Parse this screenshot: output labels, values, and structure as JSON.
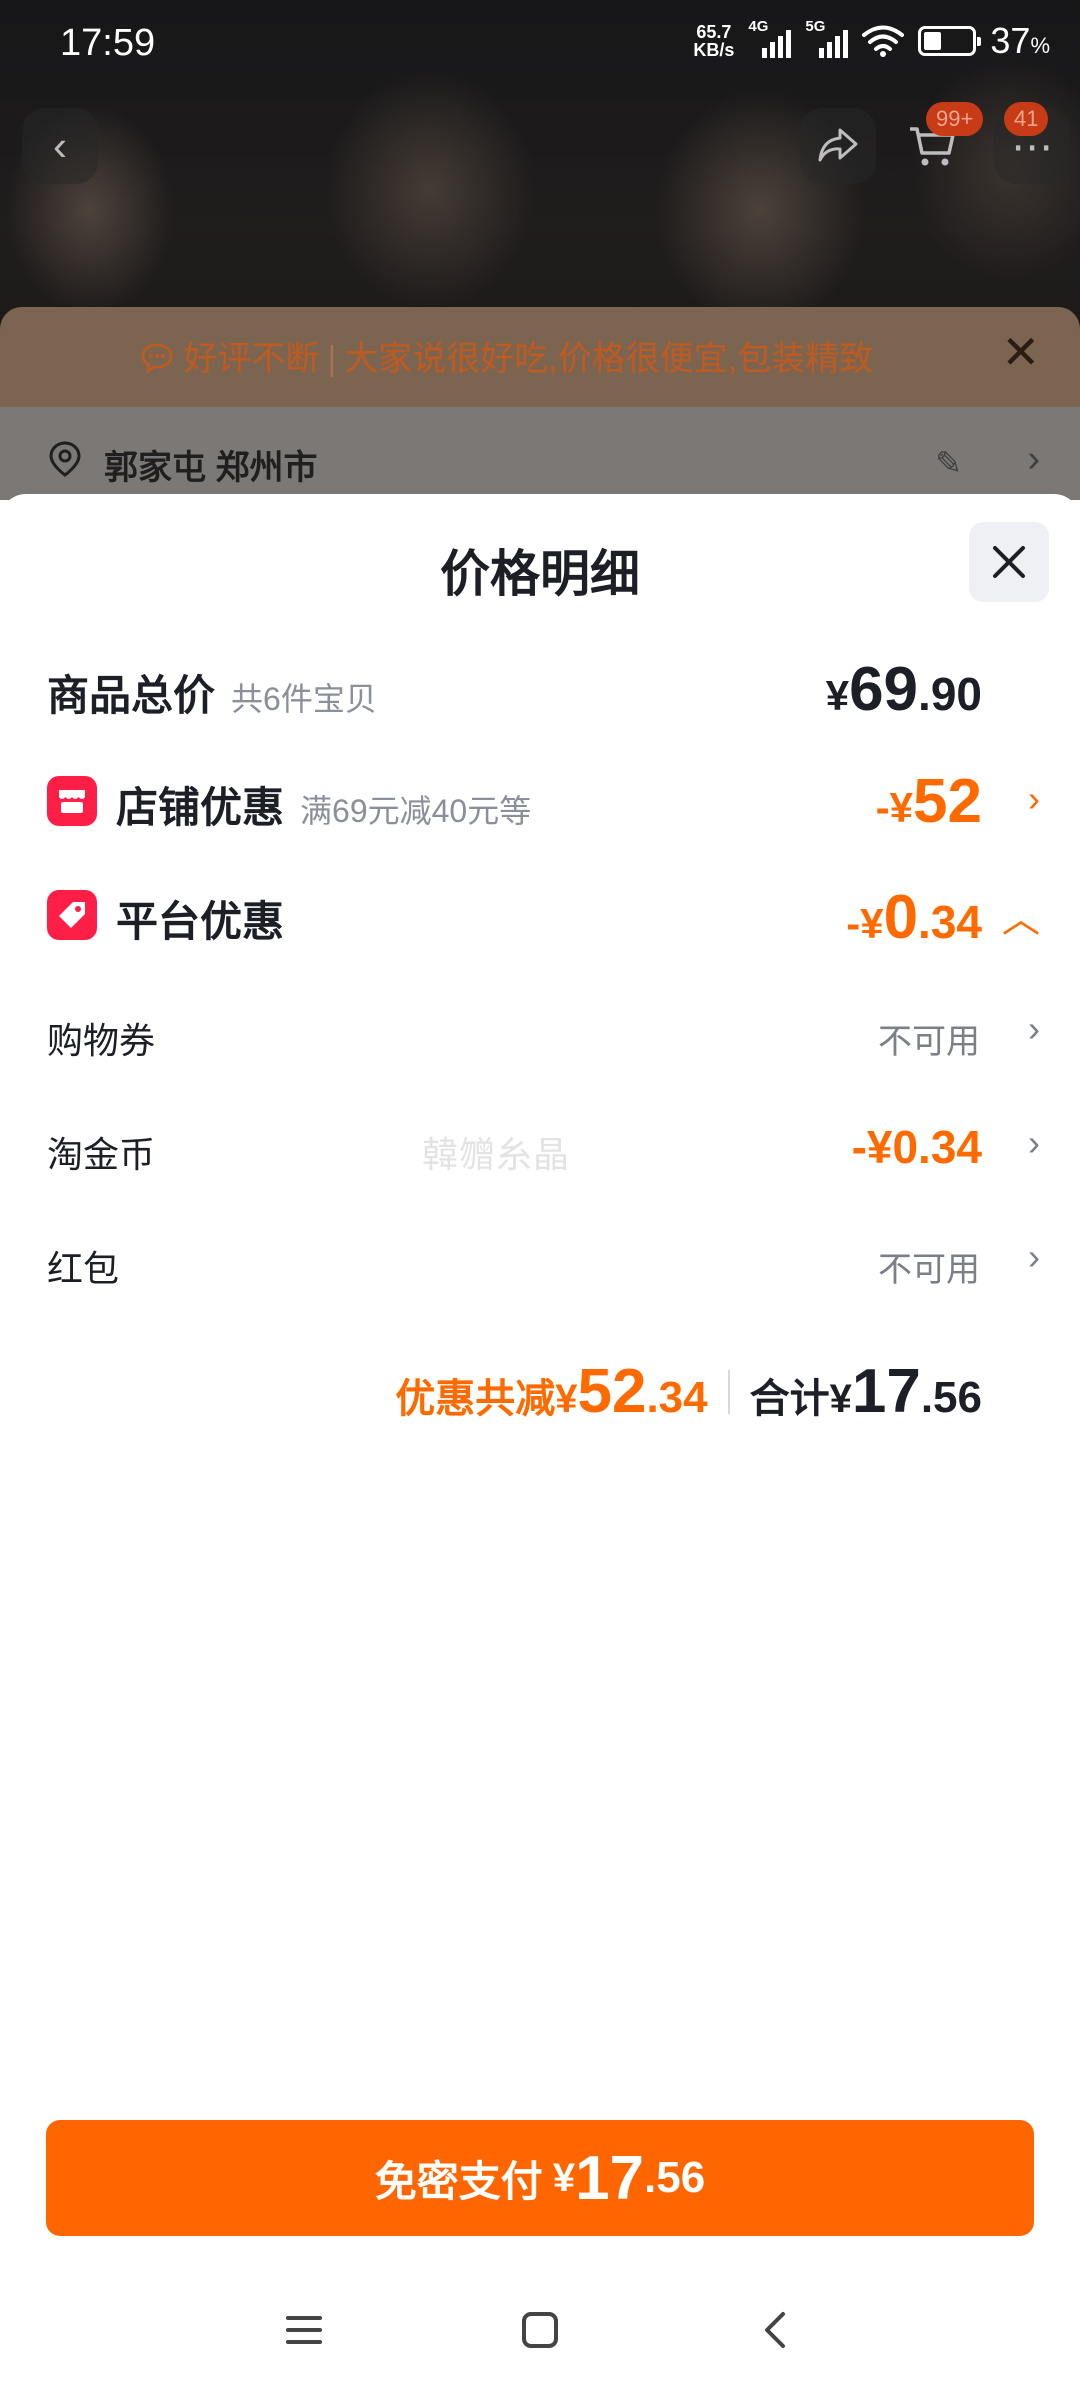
{
  "status_bar": {
    "time": "17:59",
    "net_speed_value": "65.7",
    "net_speed_unit": "KB/s",
    "sim1_label": "4G",
    "sim2_label": "5G",
    "battery_percent": "37",
    "battery_unit": "%",
    "battery_level": 0.37
  },
  "top_nav": {
    "cart_badge": "99+",
    "message_badge": "41"
  },
  "banner": {
    "tag": "好评不断",
    "text": "大家说很好吃,价格很便宜,包装精致"
  },
  "address": {
    "text": "郭家屯 郑州市"
  },
  "sheet": {
    "title": "价格明细",
    "goods_total": {
      "label": "商品总价",
      "sub": "共6件宝贝",
      "currency": "¥",
      "int": "69",
      "dec": ".90"
    },
    "store_discount": {
      "label": "店铺优惠",
      "sub": "满69元减40元等",
      "prefix": "-¥",
      "int": "52",
      "dec": ""
    },
    "platform_discount": {
      "label": "平台优惠",
      "prefix": "-¥",
      "int": "0",
      "dec": ".34"
    },
    "coupon": {
      "label": "购物券",
      "value": "不可用"
    },
    "taojin": {
      "label": "淘金币",
      "value": "-¥0.34"
    },
    "redpacket": {
      "label": "红包",
      "value": "不可用"
    },
    "summary": {
      "discount_label": "优惠共减",
      "discount_currency": "¥",
      "discount_int": "52",
      "discount_dec": ".34",
      "total_label": "合计",
      "total_currency": "¥",
      "total_int": "17",
      "total_dec": ".56"
    },
    "watermark": "韓㬟糸晶"
  },
  "pay_button": {
    "label": "免密支付",
    "currency": "¥",
    "int": "17",
    "dec": ".56"
  },
  "colors": {
    "accent_orange": "#ff6a00",
    "pay_button": "#ff6600",
    "badge_red": "#ff1f46",
    "text_dark": "#1c1f26",
    "text_gray": "#8a8f99"
  }
}
